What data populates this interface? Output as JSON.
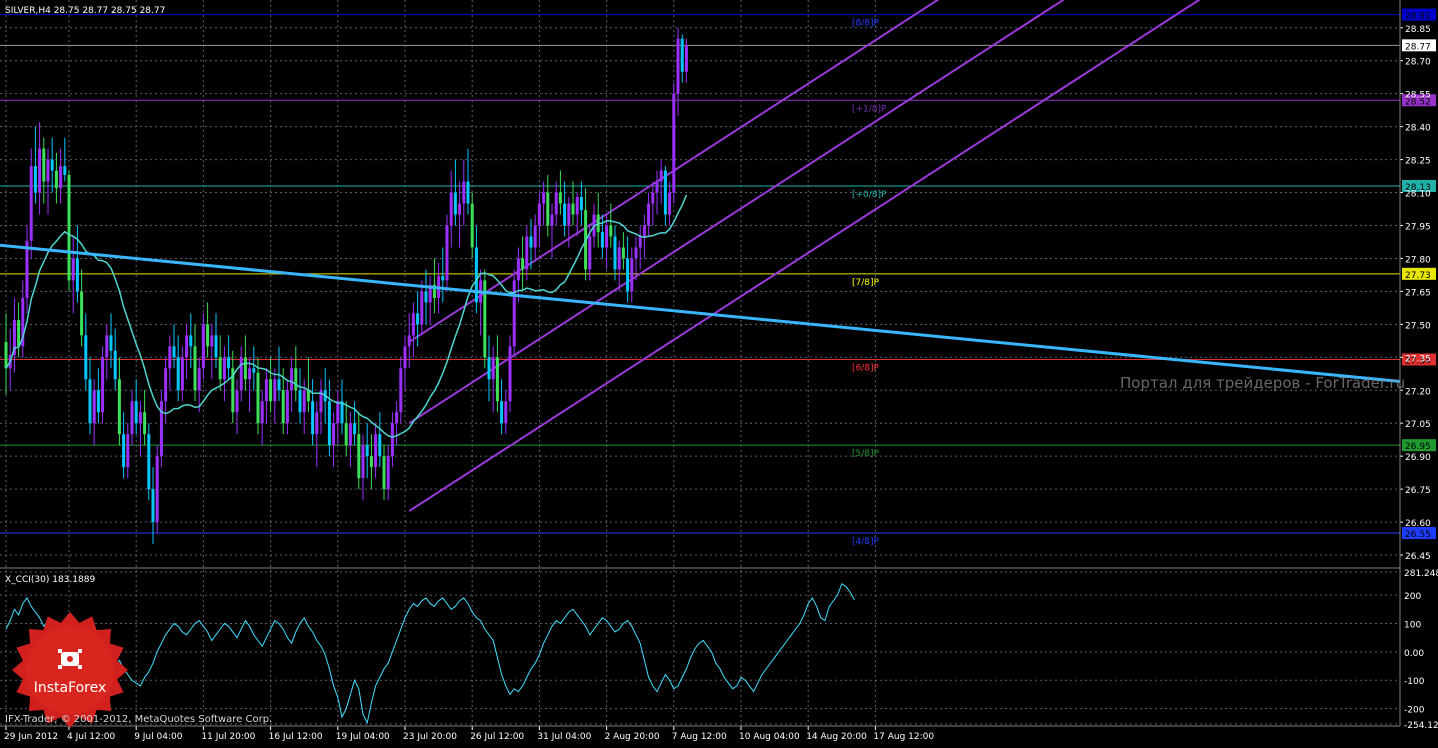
{
  "header": {
    "symbol_line": "SILVER,H4  28.75 28.77 28.75 28.77",
    "indicator_line": "X_CCI(30) 183.1889"
  },
  "footer": {
    "copyright": "IFX-Trader, © 2001-2012, MetaQuotes Software Corp."
  },
  "watermark": {
    "portal_text": "Портал для трейдеров - ForTrader.ru",
    "badge_text": "InstaForex"
  },
  "colors": {
    "background": "#000000",
    "grid": "#5a6072",
    "bull_candle": "#9b30ff",
    "bear_candle": "#00c8ff",
    "hist_green": "#3ce05a",
    "ma_line": "#4fd6d0",
    "channel": "#9a3ad8",
    "trendline": "#38b6ff",
    "cci_line": "#40e0ff",
    "badge": "#d0211e"
  },
  "price_axis": {
    "ticks": [
      "28.85",
      "28.70",
      "28.55",
      "28.40",
      "28.25",
      "28.10",
      "27.95",
      "27.80",
      "27.65",
      "27.50",
      "27.35",
      "27.20",
      "27.05",
      "26.90",
      "26.75",
      "26.60",
      "26.45"
    ],
    "tick_values": [
      28.85,
      28.7,
      28.55,
      28.4,
      28.25,
      28.1,
      27.95,
      27.8,
      27.65,
      27.5,
      27.35,
      27.2,
      27.05,
      26.9,
      26.75,
      26.6,
      26.45
    ],
    "range": [
      26.4,
      28.94
    ],
    "current_price_label": "28.77",
    "current_price": 28.77
  },
  "murrey_levels": [
    {
      "label": "[8/8]P",
      "value": 28.91,
      "price_label": "28.91",
      "color": "#0000cd",
      "label_color": "#1e3cff",
      "show_tag": true
    },
    {
      "label": "[+1/8]P",
      "value": 28.52,
      "price_label": "28.52",
      "color": "#9932cc",
      "label_color": "#7a2fb0",
      "show_tag": true
    },
    {
      "label": "[+0/8]P",
      "value": 28.13,
      "price_label": "28.13",
      "color": "#20b2aa",
      "label_color": "#20b2aa",
      "show_tag": true
    },
    {
      "label": "[7/8]P",
      "value": 27.73,
      "price_label": "27.73",
      "color": "#e6e600",
      "label_color": "#ffff00",
      "show_tag": true
    },
    {
      "label": "[6/8]P",
      "value": 27.34,
      "price_label": "27.34",
      "color": "#e03030",
      "label_color": "#ff3030",
      "show_tag": true
    },
    {
      "label": "[5/8]P",
      "value": 26.95,
      "price_label": "26.95",
      "color": "#1e9a2e",
      "label_color": "#1e9a2e",
      "show_tag": true
    },
    {
      "label": "[4/8]P",
      "value": 26.55,
      "price_label": "26.55",
      "color": "#1e3cff",
      "label_color": "#1e3cff",
      "show_tag": true
    }
  ],
  "cci_axis": {
    "ticks": [
      "281.248",
      "200",
      "100",
      "0.00",
      "-100",
      "-200",
      "-254.129"
    ],
    "tick_values": [
      281.248,
      200,
      100,
      0,
      -100,
      -200,
      -254.129
    ],
    "range": [
      -254.129,
      281.248
    ]
  },
  "time_axis": {
    "labels": [
      "29 Jun 2012",
      "4 Jul 12:00",
      "9 Jul 04:00",
      "11 Jul 20:00",
      "16 Jul 12:00",
      "19 Jul 04:00",
      "23 Jul 20:00",
      "26 Jul 12:00",
      "31 Jul 04:00",
      "2 Aug 20:00",
      "7 Aug 12:00",
      "10 Aug 04:00",
      "14 Aug 20:00",
      "17 Aug 12:00"
    ],
    "bar_index": [
      0,
      15,
      31,
      47,
      63,
      79,
      95,
      111,
      127,
      143,
      159,
      175,
      191,
      207
    ]
  },
  "chart_data": {
    "type": "candlestick",
    "symbol": "SILVER",
    "timeframe": "H4",
    "ohlc": [
      [
        27.42,
        27.55,
        27.18,
        27.3
      ],
      [
        27.3,
        27.48,
        27.2,
        27.36
      ],
      [
        27.36,
        27.62,
        27.28,
        27.52
      ],
      [
        27.52,
        27.6,
        27.35,
        27.4
      ],
      [
        27.4,
        27.7,
        27.35,
        27.62
      ],
      [
        27.62,
        27.95,
        27.55,
        27.88
      ],
      [
        27.88,
        28.3,
        27.8,
        28.22
      ],
      [
        28.22,
        28.4,
        28.05,
        28.1
      ],
      [
        28.1,
        28.42,
        28.0,
        28.3
      ],
      [
        28.3,
        28.35,
        28.05,
        28.15
      ],
      [
        28.15,
        28.3,
        28.0,
        28.25
      ],
      [
        28.25,
        28.35,
        28.1,
        28.2
      ],
      [
        28.2,
        28.28,
        28.05,
        28.12
      ],
      [
        28.12,
        28.3,
        28.05,
        28.22
      ],
      [
        28.22,
        28.35,
        28.15,
        28.18
      ],
      [
        28.18,
        28.2,
        27.65,
        27.7
      ],
      [
        27.7,
        27.9,
        27.55,
        27.8
      ],
      [
        27.8,
        27.95,
        27.6,
        27.65
      ],
      [
        27.65,
        27.75,
        27.4,
        27.45
      ],
      [
        27.45,
        27.55,
        27.2,
        27.25
      ],
      [
        27.25,
        27.35,
        27.0,
        27.05
      ],
      [
        27.05,
        27.25,
        26.95,
        27.2
      ],
      [
        27.2,
        27.3,
        27.05,
        27.1
      ],
      [
        27.1,
        27.4,
        27.05,
        27.35
      ],
      [
        27.35,
        27.5,
        27.25,
        27.45
      ],
      [
        27.45,
        27.55,
        27.3,
        27.38
      ],
      [
        27.38,
        27.48,
        27.2,
        27.25
      ],
      [
        27.25,
        27.35,
        26.95,
        27.0
      ],
      [
        27.0,
        27.1,
        26.8,
        26.85
      ],
      [
        26.85,
        27.05,
        26.8,
        27.0
      ],
      [
        27.0,
        27.2,
        26.95,
        27.15
      ],
      [
        27.15,
        27.25,
        27.0,
        27.05
      ],
      [
        27.05,
        27.15,
        26.9,
        27.1
      ],
      [
        27.1,
        27.2,
        26.95,
        27.0
      ],
      [
        27.0,
        27.05,
        26.7,
        26.75
      ],
      [
        26.75,
        26.85,
        26.5,
        26.6
      ],
      [
        26.6,
        26.95,
        26.55,
        26.9
      ],
      [
        26.9,
        27.2,
        26.85,
        27.15
      ],
      [
        27.15,
        27.35,
        27.05,
        27.3
      ],
      [
        27.3,
        27.45,
        27.2,
        27.4
      ],
      [
        27.4,
        27.5,
        27.3,
        27.35
      ],
      [
        27.35,
        27.45,
        27.15,
        27.2
      ],
      [
        27.2,
        27.4,
        27.15,
        27.35
      ],
      [
        27.35,
        27.5,
        27.25,
        27.45
      ],
      [
        27.45,
        27.55,
        27.3,
        27.4
      ],
      [
        27.4,
        27.5,
        27.15,
        27.2
      ],
      [
        27.2,
        27.35,
        27.1,
        27.3
      ],
      [
        27.3,
        27.55,
        27.25,
        27.5
      ],
      [
        27.5,
        27.6,
        27.35,
        27.4
      ],
      [
        27.4,
        27.5,
        27.25,
        27.45
      ],
      [
        27.45,
        27.55,
        27.3,
        27.35
      ],
      [
        27.35,
        27.45,
        27.2,
        27.25
      ],
      [
        27.25,
        27.4,
        27.15,
        27.35
      ],
      [
        27.35,
        27.45,
        27.25,
        27.3
      ],
      [
        27.3,
        27.38,
        27.05,
        27.1
      ],
      [
        27.1,
        27.25,
        27.0,
        27.2
      ],
      [
        27.2,
        27.4,
        27.15,
        27.35
      ],
      [
        27.35,
        27.45,
        27.2,
        27.25
      ],
      [
        27.25,
        27.35,
        27.1,
        27.3
      ],
      [
        27.3,
        27.4,
        27.2,
        27.28
      ],
      [
        27.28,
        27.35,
        27.0,
        27.05
      ],
      [
        27.05,
        27.2,
        26.95,
        27.15
      ],
      [
        27.15,
        27.3,
        27.05,
        27.25
      ],
      [
        27.25,
        27.35,
        27.1,
        27.15
      ],
      [
        27.15,
        27.3,
        27.05,
        27.25
      ],
      [
        27.25,
        27.4,
        27.15,
        27.2
      ],
      [
        27.2,
        27.3,
        27.0,
        27.05
      ],
      [
        27.05,
        27.25,
        27.0,
        27.2
      ],
      [
        27.2,
        27.35,
        27.1,
        27.3
      ],
      [
        27.3,
        27.4,
        27.15,
        27.2
      ],
      [
        27.2,
        27.3,
        27.05,
        27.1
      ],
      [
        27.1,
        27.25,
        27.0,
        27.2
      ],
      [
        27.2,
        27.35,
        27.1,
        27.15
      ],
      [
        27.15,
        27.25,
        26.95,
        27.0
      ],
      [
        27.0,
        27.15,
        26.85,
        27.1
      ],
      [
        27.1,
        27.25,
        27.0,
        27.2
      ],
      [
        27.2,
        27.3,
        27.05,
        27.15
      ],
      [
        27.15,
        27.25,
        26.9,
        26.95
      ],
      [
        26.95,
        27.1,
        26.85,
        27.05
      ],
      [
        27.05,
        27.2,
        26.95,
        27.15
      ],
      [
        27.15,
        27.25,
        27.0,
        27.05
      ],
      [
        27.05,
        27.15,
        26.9,
        26.95
      ],
      [
        26.95,
        27.1,
        26.85,
        27.05
      ],
      [
        27.05,
        27.15,
        26.95,
        27.0
      ],
      [
        27.0,
        27.1,
        26.75,
        26.8
      ],
      [
        26.8,
        27.0,
        26.7,
        26.95
      ],
      [
        26.95,
        27.05,
        26.8,
        26.9
      ],
      [
        26.9,
        27.0,
        26.75,
        26.85
      ],
      [
        26.85,
        27.05,
        26.8,
        27.0
      ],
      [
        27.0,
        27.1,
        26.85,
        26.9
      ],
      [
        26.9,
        26.95,
        26.7,
        26.75
      ],
      [
        26.75,
        26.95,
        26.7,
        26.9
      ],
      [
        26.9,
        27.1,
        26.85,
        27.05
      ],
      [
        27.05,
        27.15,
        26.95,
        27.1
      ],
      [
        27.1,
        27.35,
        27.05,
        27.3
      ],
      [
        27.3,
        27.45,
        27.2,
        27.4
      ],
      [
        27.4,
        27.55,
        27.3,
        27.45
      ],
      [
        27.45,
        27.6,
        27.35,
        27.55
      ],
      [
        27.55,
        27.65,
        27.4,
        27.5
      ],
      [
        27.5,
        27.7,
        27.45,
        27.65
      ],
      [
        27.65,
        27.75,
        27.5,
        27.6
      ],
      [
        27.6,
        27.72,
        27.5,
        27.68
      ],
      [
        27.68,
        27.8,
        27.55,
        27.62
      ],
      [
        27.62,
        27.78,
        27.55,
        27.72
      ],
      [
        27.72,
        27.85,
        27.6,
        27.7
      ],
      [
        27.7,
        28.0,
        27.65,
        27.95
      ],
      [
        27.95,
        28.2,
        27.85,
        28.1
      ],
      [
        28.1,
        28.25,
        27.95,
        28.0
      ],
      [
        28.0,
        28.15,
        27.85,
        28.05
      ],
      [
        28.05,
        28.25,
        27.95,
        28.15
      ],
      [
        28.15,
        28.3,
        28.0,
        28.05
      ],
      [
        28.05,
        28.1,
        27.8,
        27.85
      ],
      [
        27.85,
        27.95,
        27.55,
        27.6
      ],
      [
        27.6,
        27.75,
        27.45,
        27.7
      ],
      [
        27.7,
        27.75,
        27.3,
        27.35
      ],
      [
        27.35,
        27.45,
        27.15,
        27.25
      ],
      [
        27.25,
        27.4,
        27.1,
        27.35
      ],
      [
        27.35,
        27.45,
        27.1,
        27.15
      ],
      [
        27.15,
        27.25,
        27.0,
        27.05
      ],
      [
        27.05,
        27.2,
        27.0,
        27.15
      ],
      [
        27.15,
        27.45,
        27.1,
        27.4
      ],
      [
        27.4,
        27.75,
        27.35,
        27.7
      ],
      [
        27.7,
        27.85,
        27.6,
        27.8
      ],
      [
        27.8,
        27.9,
        27.65,
        27.75
      ],
      [
        27.75,
        27.95,
        27.7,
        27.9
      ],
      [
        27.9,
        27.98,
        27.75,
        27.85
      ],
      [
        27.85,
        28.0,
        27.8,
        27.95
      ],
      [
        27.95,
        28.1,
        27.85,
        28.05
      ],
      [
        28.05,
        28.15,
        27.95,
        28.1
      ],
      [
        28.1,
        28.18,
        27.9,
        27.95
      ],
      [
        27.95,
        28.05,
        27.8,
        28.0
      ],
      [
        28.0,
        28.15,
        27.95,
        28.1
      ],
      [
        28.1,
        28.2,
        28.0,
        28.05
      ],
      [
        28.05,
        28.15,
        27.9,
        27.95
      ],
      [
        27.95,
        28.08,
        27.85,
        28.05
      ],
      [
        28.05,
        28.15,
        27.95,
        28.0
      ],
      [
        28.0,
        28.1,
        27.9,
        28.08
      ],
      [
        28.08,
        28.15,
        27.95,
        28.02
      ],
      [
        28.02,
        28.12,
        27.7,
        27.75
      ],
      [
        27.75,
        27.95,
        27.7,
        27.9
      ],
      [
        27.9,
        28.05,
        27.85,
        28.0
      ],
      [
        28.0,
        28.1,
        27.85,
        27.92
      ],
      [
        27.92,
        28.0,
        27.8,
        27.85
      ],
      [
        27.85,
        28.0,
        27.75,
        27.95
      ],
      [
        27.95,
        28.05,
        27.85,
        27.9
      ],
      [
        27.9,
        27.95,
        27.7,
        27.75
      ],
      [
        27.75,
        27.88,
        27.65,
        27.85
      ],
      [
        27.85,
        27.92,
        27.75,
        27.8
      ],
      [
        27.8,
        27.9,
        27.6,
        27.65
      ],
      [
        27.65,
        27.85,
        27.6,
        27.8
      ],
      [
        27.8,
        27.9,
        27.7,
        27.85
      ],
      [
        27.85,
        27.95,
        27.75,
        27.9
      ],
      [
        27.9,
        28.0,
        27.8,
        27.95
      ],
      [
        27.95,
        28.1,
        27.9,
        28.05
      ],
      [
        28.05,
        28.15,
        27.95,
        28.1
      ],
      [
        28.1,
        28.2,
        28.0,
        28.15
      ],
      [
        28.15,
        28.25,
        28.05,
        28.2
      ],
      [
        28.2,
        28.22,
        27.95,
        28.0
      ],
      [
        28.0,
        28.15,
        27.95,
        28.1
      ],
      [
        28.1,
        28.6,
        28.05,
        28.55
      ],
      [
        28.55,
        28.85,
        28.45,
        28.8
      ],
      [
        28.8,
        28.82,
        28.6,
        28.65
      ],
      [
        28.65,
        28.8,
        28.6,
        28.77
      ]
    ],
    "ma_period": 20,
    "ma_label": "",
    "cci": {
      "name": "X_CCI(30)",
      "last_value": 183.1889,
      "values": [
        80,
        110,
        150,
        130,
        170,
        190,
        160,
        140,
        120,
        90,
        110,
        80,
        40,
        20,
        -10,
        -50,
        -70,
        -90,
        -120,
        -140,
        -150,
        -110,
        -80,
        -60,
        -70,
        -40,
        -50,
        -30,
        -60,
        -80,
        -100,
        -110,
        -120,
        -90,
        -70,
        -40,
        0,
        30,
        60,
        80,
        100,
        90,
        70,
        60,
        80,
        100,
        110,
        90,
        70,
        40,
        60,
        80,
        100,
        90,
        70,
        50,
        80,
        110,
        90,
        60,
        40,
        20,
        50,
        80,
        110,
        100,
        80,
        50,
        30,
        70,
        100,
        120,
        90,
        70,
        40,
        20,
        -10,
        -60,
        -120,
        -160,
        -230,
        -200,
        -150,
        -100,
        -130,
        -220,
        -250,
        -180,
        -120,
        -90,
        -60,
        -40,
        0,
        40,
        80,
        120,
        150,
        170,
        160,
        180,
        190,
        170,
        160,
        180,
        190,
        170,
        150,
        160,
        180,
        190,
        170,
        140,
        120,
        110,
        80,
        60,
        40,
        -20,
        -80,
        -120,
        -150,
        -130,
        -140,
        -120,
        -90,
        -60,
        -40,
        -10,
        30,
        60,
        90,
        110,
        100,
        120,
        140,
        150,
        130,
        110,
        90,
        60,
        80,
        100,
        120,
        110,
        90,
        70,
        80,
        100,
        110,
        90,
        60,
        30,
        -30,
        -90,
        -120,
        -140,
        -110,
        -80,
        -100,
        -130,
        -120,
        -90,
        -60,
        -20,
        10,
        30,
        40,
        20,
        0,
        -40,
        -60,
        -90,
        -110,
        -130,
        -120,
        -90,
        -100,
        -120,
        -140,
        -110,
        -80,
        -60,
        -40,
        -20,
        0,
        20,
        40,
        60,
        80,
        100,
        130,
        170,
        190,
        160,
        120,
        110,
        160,
        180,
        200,
        240,
        230,
        210,
        183
      ]
    }
  }
}
